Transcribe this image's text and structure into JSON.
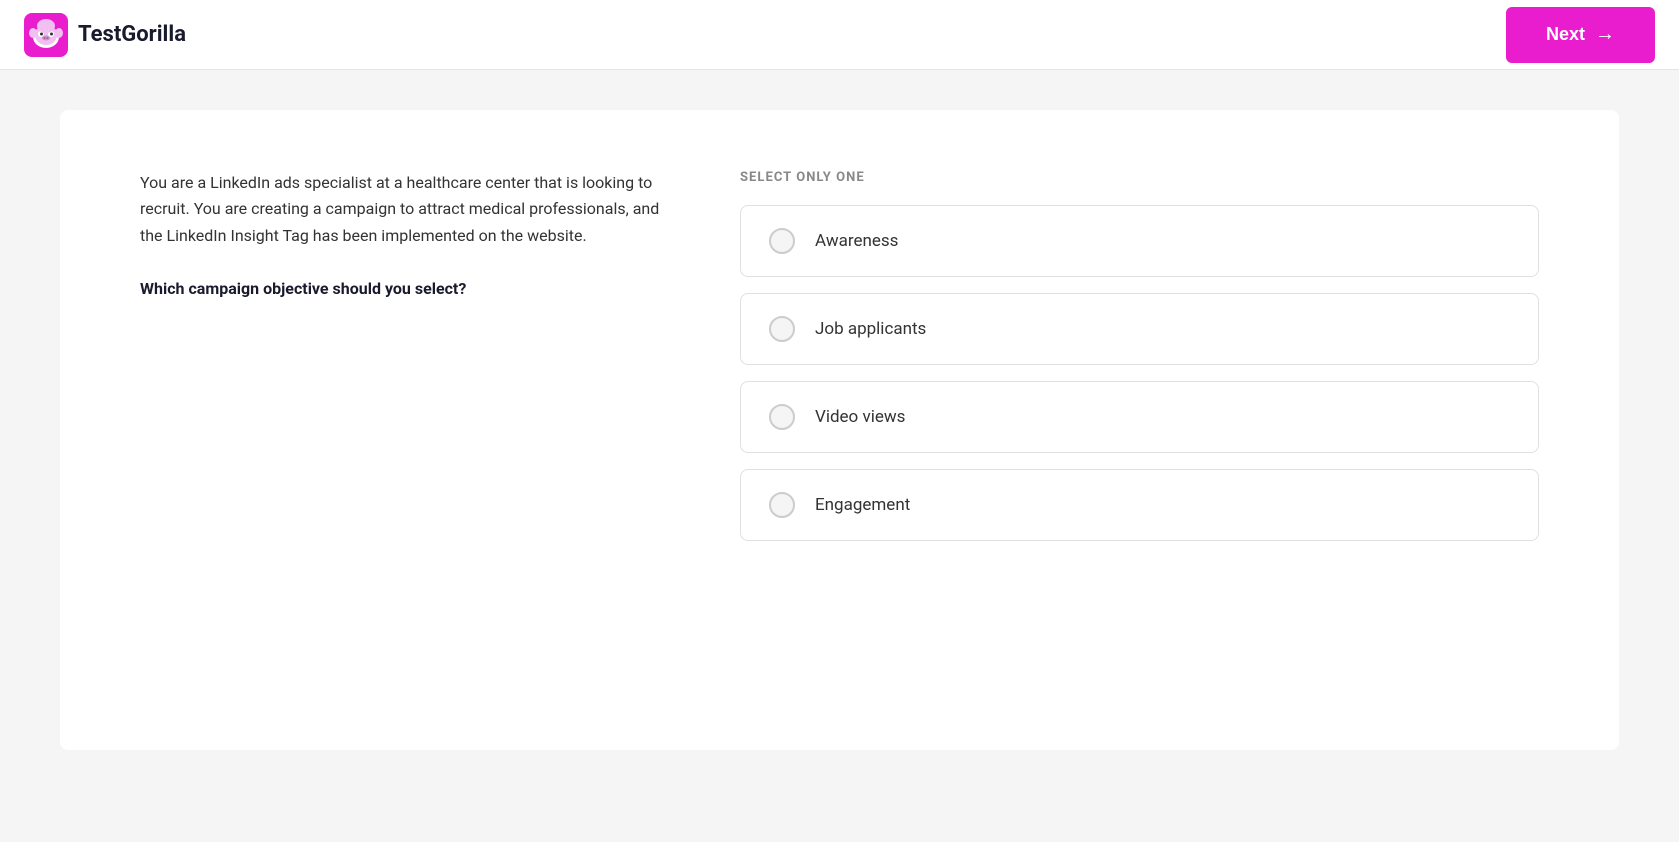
{
  "header": {
    "logo_text": "TestGorilla",
    "next_button_label": "Next",
    "next_arrow": "→"
  },
  "main": {
    "scenario": "You are a LinkedIn ads specialist at a healthcare center that is looking to recruit. You are creating a campaign to attract medical professionals, and the LinkedIn Insight Tag has been implemented on the website.",
    "question": "Which campaign objective should you select?",
    "select_instruction": "SELECT ONLY ONE",
    "options": [
      {
        "id": "awareness",
        "label": "Awareness"
      },
      {
        "id": "job-applicants",
        "label": "Job applicants"
      },
      {
        "id": "video-views",
        "label": "Video views"
      },
      {
        "id": "engagement",
        "label": "Engagement"
      }
    ]
  }
}
